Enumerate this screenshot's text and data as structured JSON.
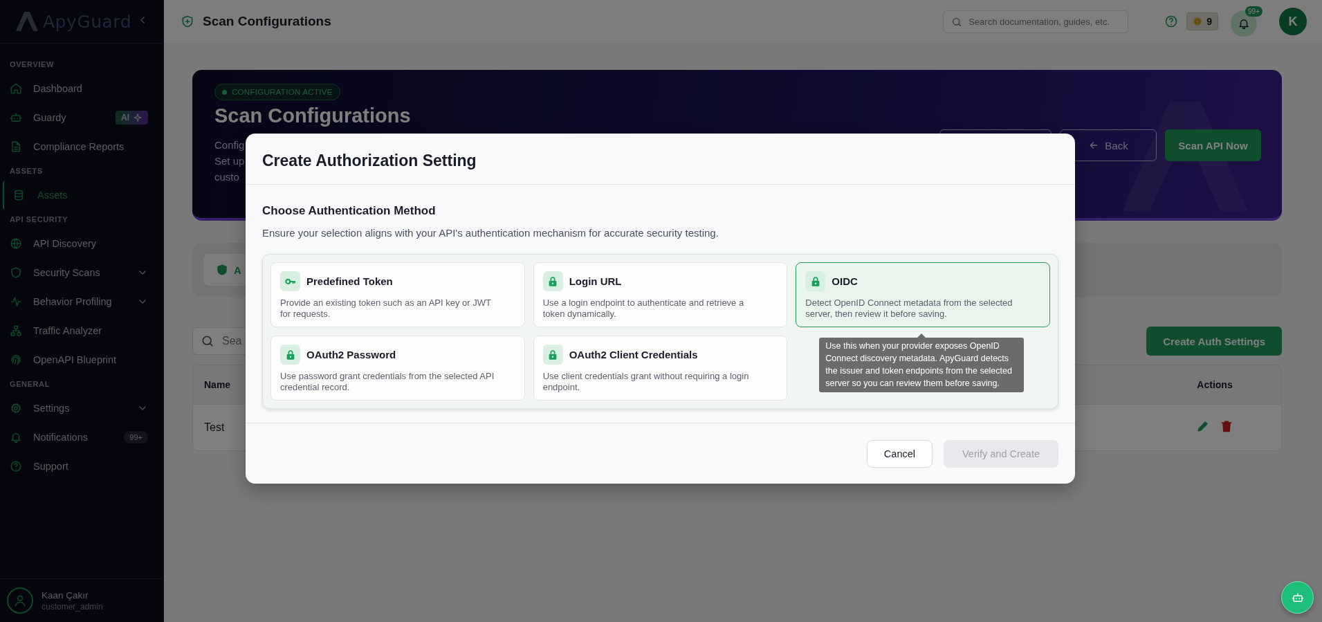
{
  "sidebar": {
    "logo": "ApyGuard",
    "sections": [
      {
        "title": "OVERVIEW",
        "items": [
          {
            "label": "Dashboard",
            "selected": false,
            "expandable": false
          },
          {
            "label": "Guardy",
            "selected": false,
            "expandable": false,
            "badge": {
              "label": "AI",
              "kind": "ai"
            }
          },
          {
            "label": "Compliance Reports",
            "selected": false,
            "expandable": false
          }
        ]
      },
      {
        "title": "ASSETS",
        "items": [
          {
            "label": "Assets",
            "selected": true,
            "expandable": false
          }
        ]
      },
      {
        "title": "API SECURITY",
        "items": [
          {
            "label": "API Discovery",
            "selected": false,
            "expandable": false
          },
          {
            "label": "Security Scans",
            "selected": false,
            "expandable": true
          },
          {
            "label": "Behavior Profiling",
            "selected": false,
            "expandable": true
          },
          {
            "label": "Traffic Analyzer",
            "selected": false,
            "expandable": false
          },
          {
            "label": "OpenAPI Blueprint",
            "selected": false,
            "expandable": false
          }
        ]
      },
      {
        "title": "GENERAL",
        "items": [
          {
            "label": "Settings",
            "selected": false,
            "expandable": true
          },
          {
            "label": "Notifications",
            "selected": false,
            "expandable": false,
            "badge": {
              "label": "99+",
              "kind": "count"
            }
          },
          {
            "label": "Support",
            "selected": false,
            "expandable": false
          }
        ]
      }
    ],
    "user": {
      "name": "Kaan Çakır",
      "role": "customer_admin"
    }
  },
  "header": {
    "title": "Scan Configurations",
    "search": {
      "placeholder": "Search documentation, guides, etc."
    },
    "credits": "9",
    "notifications": "99+",
    "avatar": "K"
  },
  "hero": {
    "status": "CONFIGURATION ACTIVE",
    "title": "Scan Configurations",
    "description": [
      "Config",
      "Set up",
      "custo"
    ],
    "buttons": [
      {
        "label": "Back",
        "kind": "back"
      },
      {
        "label": "Scan API Now",
        "kind": "primary"
      }
    ]
  },
  "tab_strip": {
    "tab": "A"
  },
  "search": {
    "placeholder": "Sea"
  },
  "create_button": "Create Auth Settings",
  "table": {
    "columns": [
      "Name",
      "Actions"
    ],
    "rows": [
      {
        "name": "Test"
      }
    ]
  },
  "modal": {
    "title": "Create Authorization Setting",
    "section_title": "Choose Authentication Method",
    "description": "Ensure your selection aligns with your API's authentication mechanism for accurate security testing.",
    "methods": [
      {
        "title": "Predefined Token",
        "description": "Provide an existing token such as an API key or JWT for requests.",
        "selected": false
      },
      {
        "title": "Login URL",
        "description": "Use a login endpoint to authenticate and retrieve a token dynamically.",
        "selected": false
      },
      {
        "title": "OIDC",
        "description": "Detect OpenID Connect metadata from the selected server, then review it before saving.",
        "selected": true
      },
      {
        "title": "OAuth2 Password",
        "description": "Use password grant credentials from the selected API credential record.",
        "selected": false
      },
      {
        "title": "OAuth2 Client Credentials",
        "description": "Use client credentials grant without requiring a login endpoint.",
        "selected": false
      }
    ],
    "tooltip": "Use this when your provider exposes OpenID Connect discovery metadata. ApyGuard detects the issuer and token endpoints from the selected server so you can review them before saving.",
    "buttons": [
      {
        "label": "Cancel",
        "disabled": false
      },
      {
        "label": "Verify and Create",
        "disabled": true
      }
    ]
  }
}
